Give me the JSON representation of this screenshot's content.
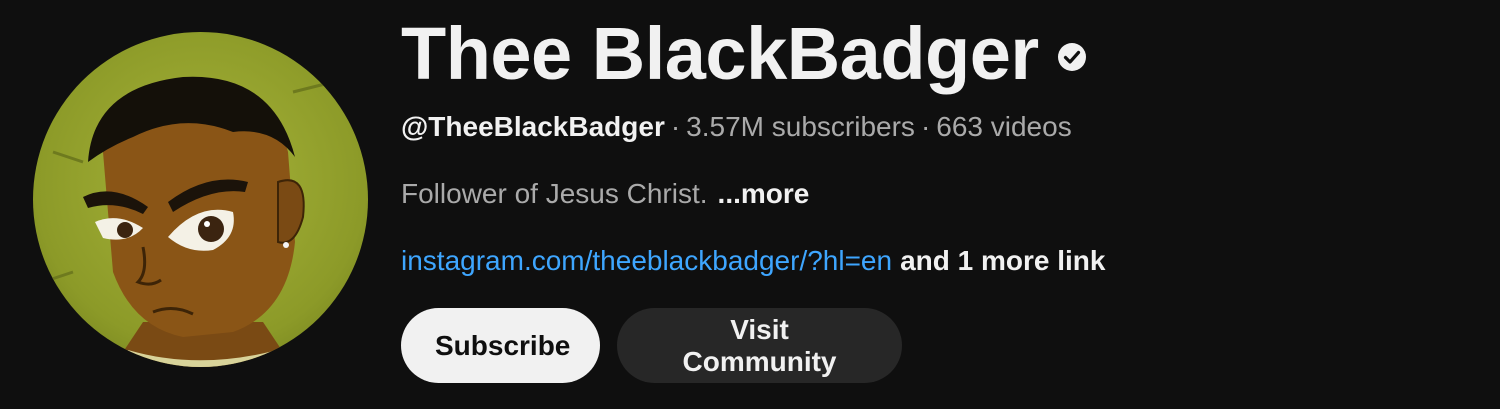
{
  "channel": {
    "name": "Thee BlackBadger",
    "verified": true,
    "handle": "@TheeBlackBadger",
    "separator": "·",
    "subscribers": "3.57M subscribers",
    "videos": "663 videos",
    "description": "Follower of Jesus Christ.",
    "more_label": "...more",
    "link_text": "instagram.com/theeblackbadger/?hl=en",
    "more_links_label": "and 1 more link"
  },
  "buttons": {
    "subscribe_label": "Subscribe",
    "community_label": "Visit Community"
  },
  "icons": {
    "verified": "verified-check-icon",
    "avatar": "cartoon-avatar"
  },
  "colors": {
    "background": "#0f0f0f",
    "text_primary": "#f1f1f1",
    "text_secondary": "#aaaaaa",
    "link": "#3ea6ff",
    "subscribe_bg": "#f1f1f1",
    "community_bg": "#272727"
  }
}
